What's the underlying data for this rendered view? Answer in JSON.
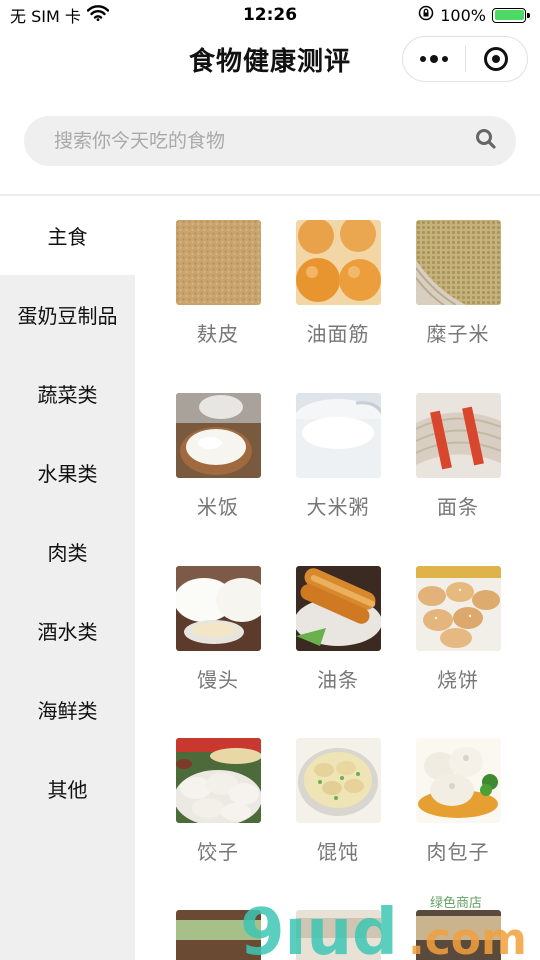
{
  "status_bar": {
    "carrier": "无 SIM 卡",
    "time": "12:26",
    "battery": "100%",
    "battery_level": 1.0
  },
  "nav": {
    "title": "食物健康测评"
  },
  "search": {
    "placeholder": "搜索你今天吃的食物"
  },
  "sidebar": {
    "items": [
      {
        "label": "主食",
        "active": true
      },
      {
        "label": "蛋奶豆制品",
        "active": false
      },
      {
        "label": "蔬菜类",
        "active": false
      },
      {
        "label": "水果类",
        "active": false
      },
      {
        "label": "肉类",
        "active": false
      },
      {
        "label": "酒水类",
        "active": false
      },
      {
        "label": "海鲜类",
        "active": false
      },
      {
        "label": "其他",
        "active": false
      }
    ]
  },
  "foods": [
    {
      "name": "麸皮"
    },
    {
      "name": "油面筋"
    },
    {
      "name": "糜子米"
    },
    {
      "name": "米饭"
    },
    {
      "name": "大米粥"
    },
    {
      "name": "面条"
    },
    {
      "name": "馒头"
    },
    {
      "name": "油条"
    },
    {
      "name": "烧饼"
    },
    {
      "name": "饺子"
    },
    {
      "name": "馄饨"
    },
    {
      "name": "肉包子"
    }
  ],
  "watermark": {
    "main": "9ıud.com",
    "sub": "绿色商店"
  }
}
